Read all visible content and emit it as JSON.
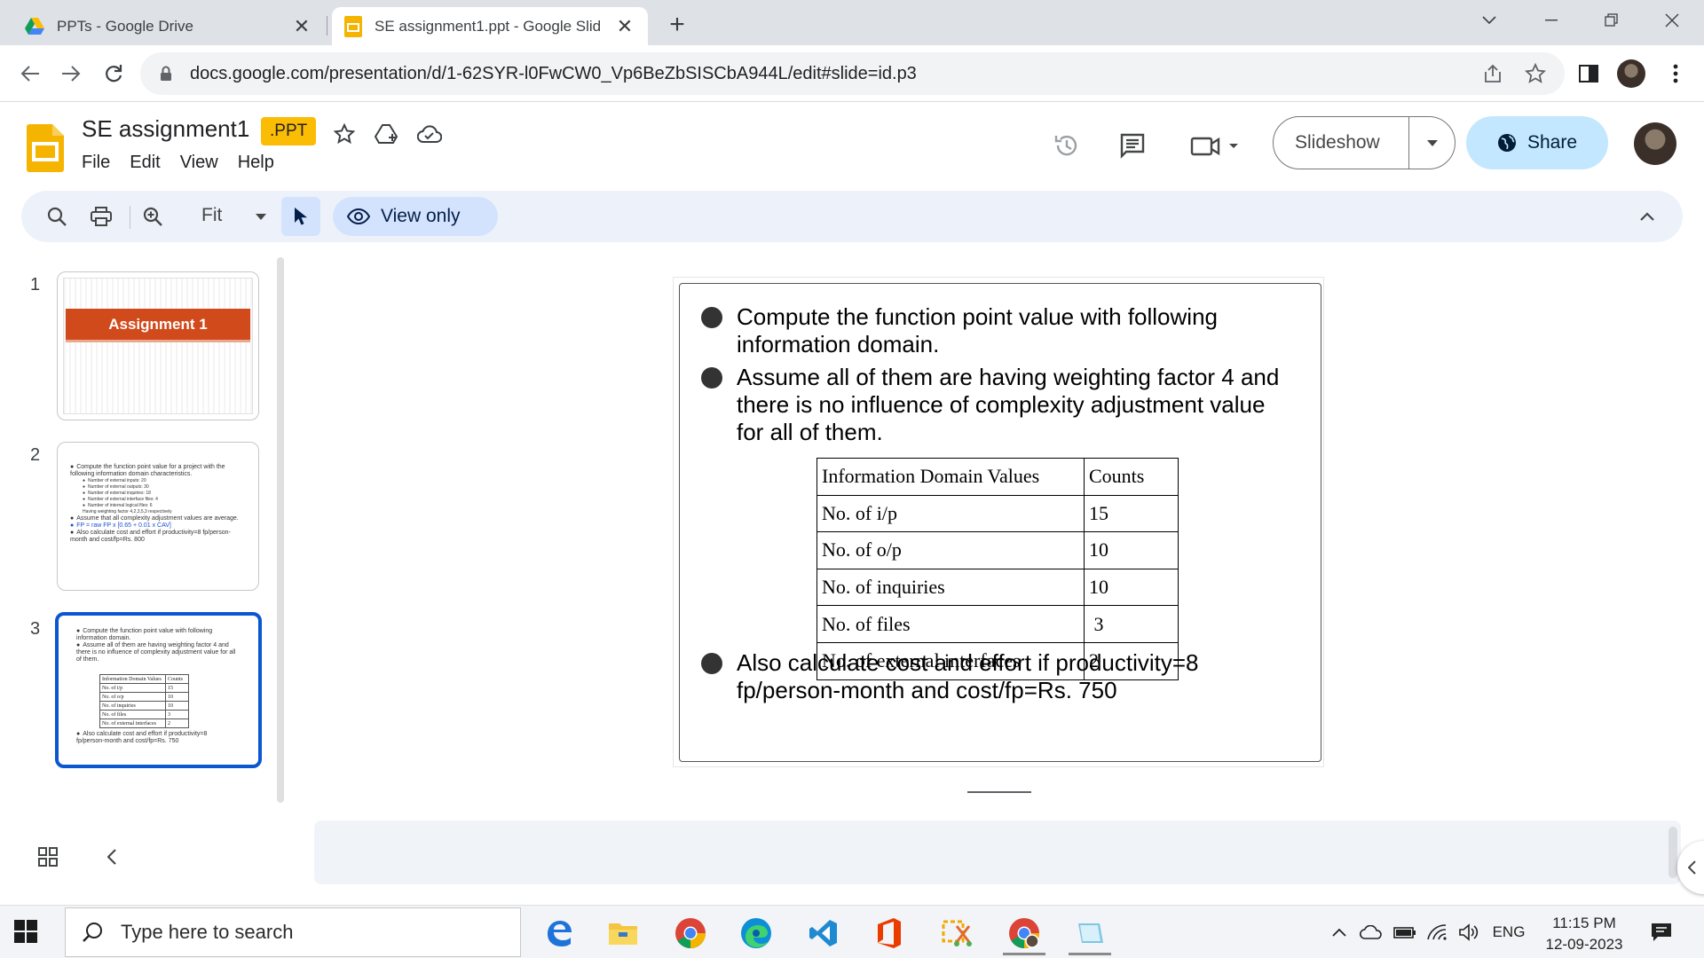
{
  "browser": {
    "tabs": [
      {
        "title": "PPTs - Google Drive"
      },
      {
        "title": "SE assignment1.ppt - Google Slid"
      }
    ],
    "url": "docs.google.com/presentation/d/1-62SYR-l0FwCW0_Vp6BeZbSISCbA944L/edit#slide=id.p3"
  },
  "app": {
    "title": "SE assignment1",
    "badge": ".PPT",
    "menu": [
      "File",
      "Edit",
      "View",
      "Help"
    ],
    "slideshow_label": "Slideshow",
    "share_label": "Share"
  },
  "toolbar": {
    "zoom_label": "Fit",
    "view_only_label": "View only"
  },
  "filmstrip": {
    "slides": [
      {
        "number": "1",
        "title": "Assignment 1"
      },
      {
        "number": "2",
        "lines": [
          "Compute the function point value for a project with the following information domain characteristics.",
          "Number of external inputs:        20",
          "Number of external outputs:       30",
          "Number of external inquiries:     18",
          "Number of external interface files:  4",
          "Number of internal logical files:   6",
          "Having weighting factor 4,2,3,5,3 respectively",
          "Assume that all complexity adjustment values are average.",
          "FP = raw FP x [0.65 + 0.01 x CAV]",
          "Also calculate cost and effort if productivity=8 fp/person-month and cost/fp=Rs. 800"
        ]
      },
      {
        "number": "3"
      }
    ]
  },
  "slide": {
    "bullets": [
      "Compute the function point value with following information domain.",
      "Assume all of them are having weighting factor 4 and there is no influence of complexity adjustment value for all of them.",
      "Also calculate cost and effort if productivity=8 fp/person-month and cost/fp=Rs. 750"
    ],
    "table": {
      "header": [
        "Information Domain Values",
        "Counts"
      ],
      "rows": [
        [
          "No. of i/p",
          "15"
        ],
        [
          "No. of o/p",
          "10"
        ],
        [
          "No. of inquiries",
          "10"
        ],
        [
          "No. of files",
          " 3"
        ],
        [
          "No. of external interfaces",
          "2"
        ]
      ]
    }
  },
  "taskbar": {
    "search_placeholder": "Type here to search",
    "language": "ENG",
    "time": "11:15 PM",
    "date": "12-09-2023"
  },
  "colors": {
    "accent_blue": "#0b57d0",
    "share_bg": "#c2e7ff",
    "badge_yellow": "#fbbc04",
    "slides_yellow": "#f4b400",
    "assignment_band": "#d04a1c"
  }
}
